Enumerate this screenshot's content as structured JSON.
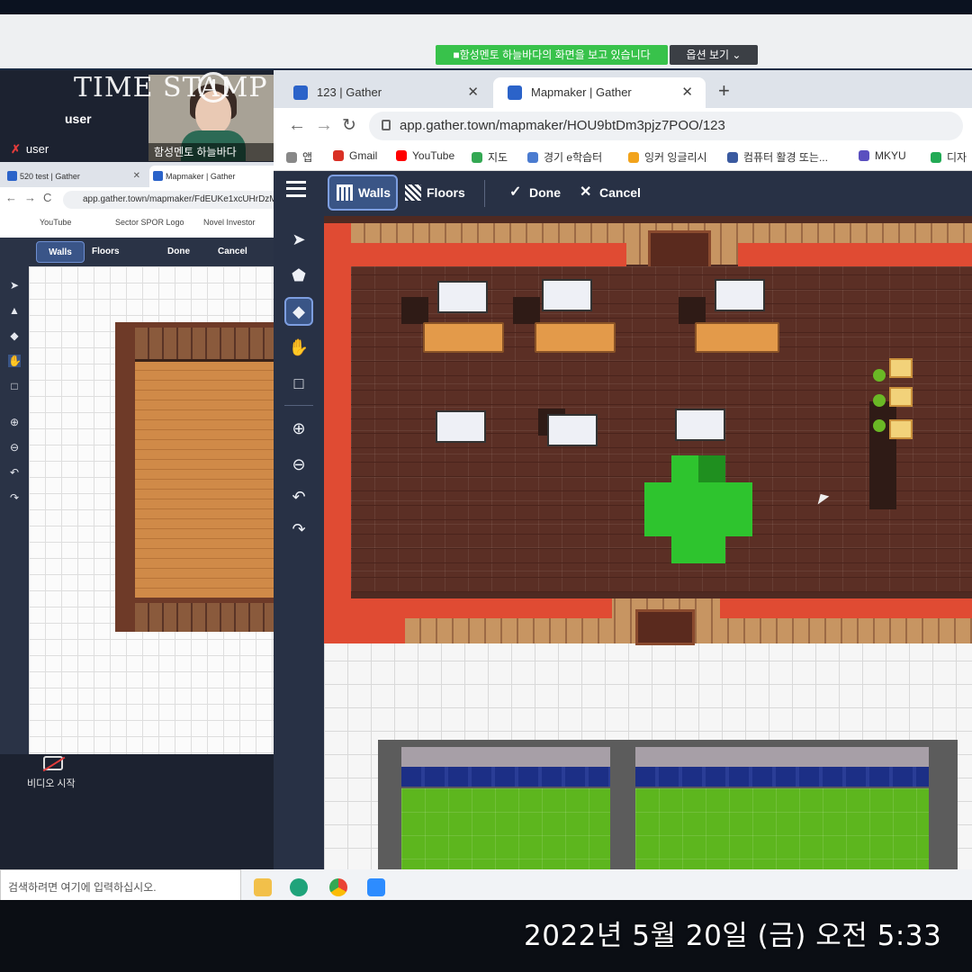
{
  "screen_share": {
    "notice": "■함성멘토 하늘바다의 화면을 보고 있습니다",
    "options_label": "옵션 보기 ⌄"
  },
  "overlay": {
    "logo_text": "TIME STAMP"
  },
  "zoom": {
    "self_name": "user",
    "participant_name": "user",
    "video_caption": "함성멘토 하늘바다",
    "video_start_label": "비디오 시작"
  },
  "small_browser": {
    "tabs": [
      {
        "label": "520 test | Gather"
      },
      {
        "label": "Mapmaker | Gather"
      }
    ],
    "url": "app.gather.town/mapmaker/FdEUKe1xcUHrDzM",
    "bookmarks": [
      "YouTube",
      "Sector SPOR Logo",
      "Novel Investor"
    ],
    "toolbar": {
      "walls": "Walls",
      "floors": "Floors",
      "done": "Done",
      "cancel": "Cancel"
    }
  },
  "main_browser": {
    "tabs": [
      {
        "label": "123 | Gather"
      },
      {
        "label": "Mapmaker | Gather"
      }
    ],
    "url": "app.gather.town/mapmaker/HOU9btDm3pjz7POO/123",
    "bookmarks": [
      {
        "label": "앱",
        "color": "#888888"
      },
      {
        "label": "Gmail",
        "color": "#d93025"
      },
      {
        "label": "YouTube",
        "color": "#ff0000"
      },
      {
        "label": "지도",
        "color": "#34a853"
      },
      {
        "label": "경기 e학습터",
        "color": "#4a7bd0"
      },
      {
        "label": "잉커 잉글리시",
        "color": "#f2a31b"
      },
      {
        "label": "컴퓨터 활경 또는...",
        "color": "#3a5aa0"
      },
      {
        "label": "MKYU",
        "color": "#5a4fbf"
      },
      {
        "label": "디자",
        "color": "#22aa55"
      }
    ]
  },
  "mapmaker": {
    "toolbar": {
      "walls_label": "Walls",
      "floors_label": "Floors",
      "done_label": "Done",
      "cancel_label": "Cancel"
    },
    "active_tool": "eraser",
    "tools": [
      "select-icon",
      "stamp-icon",
      "eraser-icon",
      "hand-icon",
      "rectangle-select-icon",
      "zoom-in-icon",
      "zoom-out-icon",
      "undo-icon",
      "redo-icon"
    ]
  },
  "taskbar": {
    "search_placeholder": "검색하려면 여기에 입력하십시오."
  },
  "photo": {
    "timestamp": "2022년 5월 20일 (금) 오전 5:33"
  }
}
